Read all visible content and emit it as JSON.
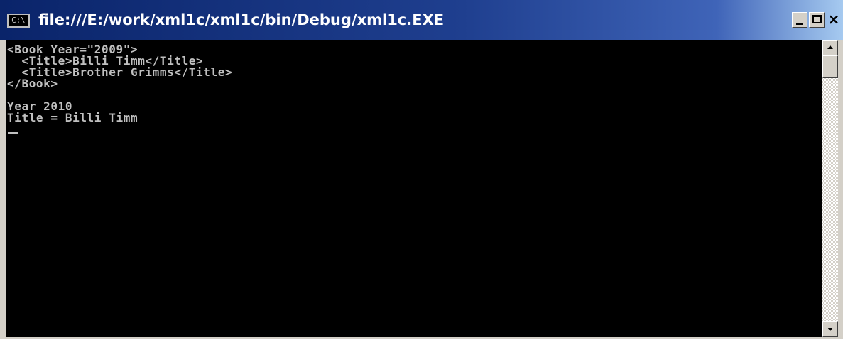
{
  "window": {
    "title": "file:///E:/work/xml1c/xml1c/bin/Debug/xml1c.EXE",
    "icon": "console-window-icon",
    "icon_text": "C:\\",
    "buttons": {
      "minimize": "minimize-icon",
      "maximize": "maximize-icon",
      "close_label": "×"
    }
  },
  "console": {
    "lines": [
      "<Book Year=\"2009\">",
      "  <Title>Billi Timm</Title>",
      "  <Title>Brother Grimms</Title>",
      "</Book>",
      "",
      "Year 2010",
      "Title = Billi Timm"
    ],
    "text_color": "#c0c0c0",
    "background": "#000000"
  },
  "scrollbar": {
    "up_icon": "arrow-up-icon",
    "down_icon": "arrow-down-icon"
  }
}
